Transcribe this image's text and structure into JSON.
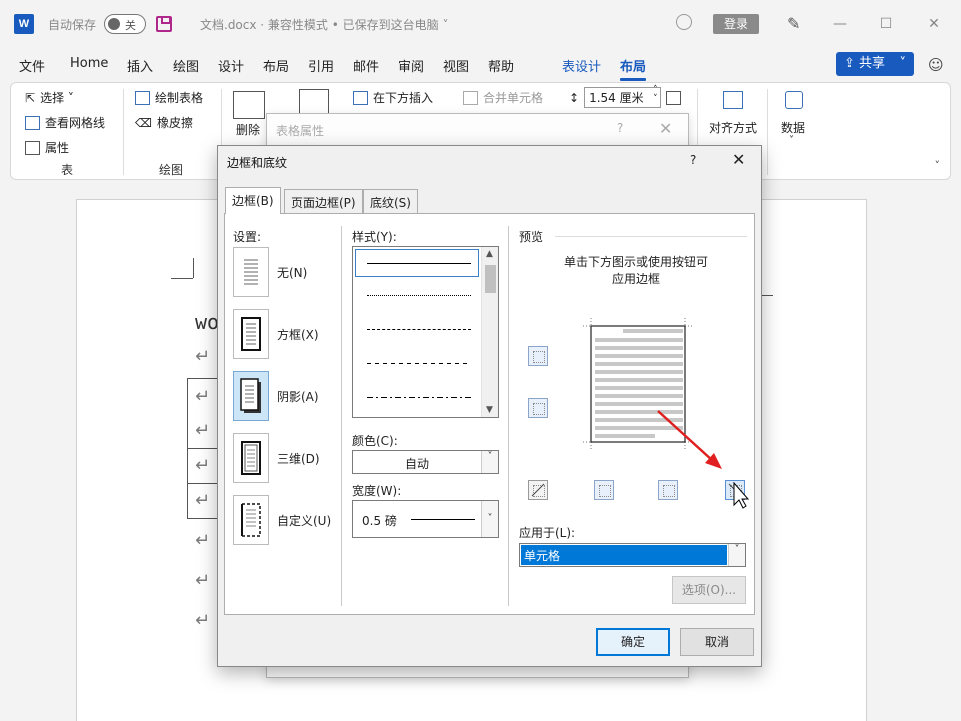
{
  "titlebar": {
    "app_logo": "W",
    "autosave_label": "自动保存",
    "autosave_toggle": "关",
    "doc_title": "文档.docx  ·  兼容性模式 • 已保存到这台电脑 ˅",
    "login": "登录",
    "icons": [
      "search-icon",
      "pen-icon",
      "minimize-icon",
      "maximize-icon",
      "close-icon"
    ]
  },
  "menu": {
    "tabs": [
      "文件",
      "Home",
      "插入",
      "绘图",
      "设计",
      "布局",
      "引用",
      "邮件",
      "审阅",
      "视图",
      "帮助"
    ],
    "context_tabs": [
      "表设计",
      "布局"
    ],
    "share": "共享"
  },
  "ribbon": {
    "select": "选择 ˅",
    "view_gridlines": "查看网格线",
    "properties": "属性",
    "group_table": "表",
    "draw_table": "绘制表格",
    "eraser": "橡皮擦",
    "group_draw": "绘图",
    "delete": "删除",
    "insert_below": "在下方插入",
    "merge_cells": "合并单元格",
    "height_value": "1.54 厘米",
    "align": "对齐方式",
    "data": "数据"
  },
  "document": {
    "heading_fragment": "wo",
    "return_mark": "↵"
  },
  "props_dialog": {
    "title": "表格属性",
    "help": "?",
    "close": "✕"
  },
  "dialog": {
    "title": "边框和底纹",
    "help": "?",
    "close": "✕",
    "tabs": [
      "边框(B)",
      "页面边框(P)",
      "底纹(S)"
    ],
    "settings_title": "设置:",
    "settings": [
      "无(N)",
      "方框(X)",
      "阴影(A)",
      "三维(D)",
      "自定义(U)"
    ],
    "style_title": "样式(Y):",
    "color_label": "颜色(C):",
    "color_value": "自动",
    "width_label": "宽度(W):",
    "width_value": "0.5 磅",
    "preview_title": "预览",
    "preview_hint_1": "单击下方图示或使用按钮可",
    "preview_hint_2": "应用边框",
    "apply_label": "应用于(L):",
    "apply_value": "单元格",
    "options": "选项(O)...",
    "ok": "确定",
    "cancel": "取消"
  },
  "colors": {
    "brand": "#185abd",
    "selection": "#0078d7",
    "arrow": "#e02020"
  }
}
